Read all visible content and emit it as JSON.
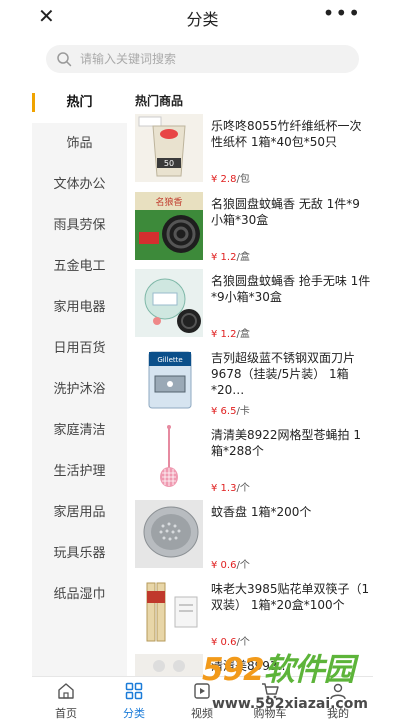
{
  "topbar": {
    "close_icon": "close-icon",
    "title": "分类",
    "more_icon": "more-dots-icon"
  },
  "search": {
    "placeholder": "请输入关键词搜索",
    "icon": "search-icon"
  },
  "sidebar": {
    "items": [
      {
        "label": "热门",
        "active": true
      },
      {
        "label": "饰品"
      },
      {
        "label": "文体办公"
      },
      {
        "label": "雨具劳保"
      },
      {
        "label": "五金电工"
      },
      {
        "label": "家用电器"
      },
      {
        "label": "日用百货"
      },
      {
        "label": "洗护沐浴"
      },
      {
        "label": "家庭清洁"
      },
      {
        "label": "生活护理"
      },
      {
        "label": "家居用品"
      },
      {
        "label": "玩具乐器"
      },
      {
        "label": "纸品湿巾"
      }
    ],
    "accent": "#f0a300"
  },
  "content": {
    "section_title": "热门商品",
    "products": [
      {
        "name": "乐咚咚8055竹纤维纸杯一次性纸杯 1箱*40包*50只",
        "price": "¥ 2.8",
        "unit": "/包",
        "thumb_text": "50"
      },
      {
        "name": "名狼圆盘蚊蝇香 无敌 1件*9小箱*30盒",
        "price": "¥ 1.2",
        "unit": "/盒",
        "thumb_text": "名狼香"
      },
      {
        "name": "名狼圆盘蚊蝇香 抢手无味 1件*9小箱*30盒",
        "price": "¥ 1.2",
        "unit": "/盒",
        "thumb_text": ""
      },
      {
        "name": "吉列超级蓝不锈钢双面刀片9678（挂装/5片装） 1箱*20…",
        "price": "¥ 6.5",
        "unit": "/卡",
        "thumb_text": "Gillette"
      },
      {
        "name": "清清美8922网格型苍蝇拍 1箱*288个",
        "price": "¥ 1.3",
        "unit": "/个",
        "thumb_text": ""
      },
      {
        "name": "蚊香盘 1箱*200个",
        "price": "¥ 0.6",
        "unit": "/个",
        "thumb_text": ""
      },
      {
        "name": "味老大3985贴花单双筷子（1双装） 1箱*20盒*100个",
        "price": "¥ 0.6",
        "unit": "/个",
        "thumb_text": ""
      },
      {
        "name": "清清美8993…",
        "price": "",
        "unit": "",
        "thumb_text": ""
      }
    ],
    "price_color": "#e02020"
  },
  "tabbar": {
    "tabs": [
      {
        "label": "首页",
        "icon": "home-icon"
      },
      {
        "label": "分类",
        "icon": "category-grid-icon",
        "active": true
      },
      {
        "label": "视频",
        "icon": "video-icon"
      },
      {
        "label": "购物车",
        "icon": "cart-icon"
      },
      {
        "label": "我的",
        "icon": "user-icon"
      }
    ],
    "active_color": "#1a7bd8"
  },
  "watermark": {
    "number": "592",
    "brand": "软件园",
    "url": "www.592xiazai.com"
  }
}
